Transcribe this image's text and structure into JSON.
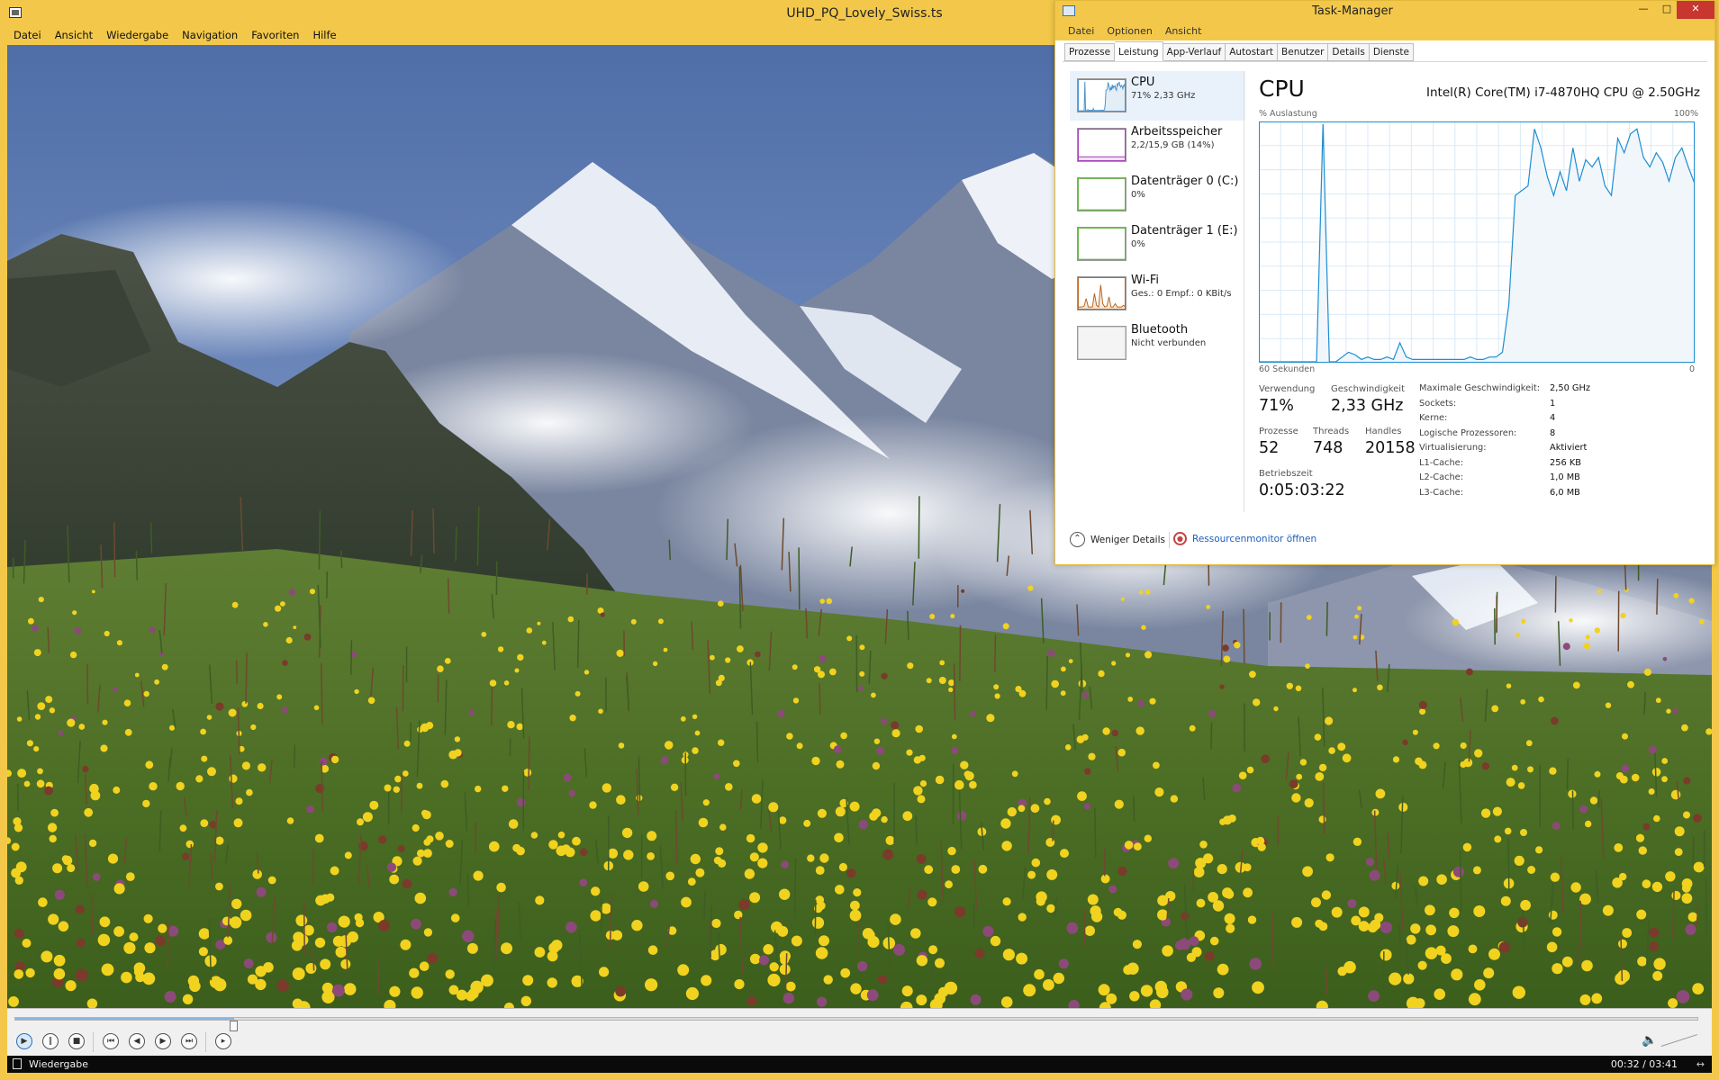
{
  "player": {
    "title": "UHD_PQ_Lovely_Swiss.ts",
    "menu": [
      "Datei",
      "Ansicht",
      "Wiedergabe",
      "Navigation",
      "Favoriten",
      "Hilfe"
    ],
    "seek_progress": 0.13,
    "status_text": "Wiedergabe",
    "time": "00:32 / 03:41",
    "resize_glyph": "↔",
    "controls": [
      {
        "name": "play-button",
        "icon": "play-icon",
        "glyph": "▶"
      },
      {
        "name": "pause-button",
        "icon": "pause-icon",
        "glyph": "‖"
      },
      {
        "name": "stop-button",
        "icon": "stop-icon",
        "glyph": "■"
      },
      {
        "name": "previous-button",
        "icon": "skip-back-icon",
        "glyph": "⏮"
      },
      {
        "name": "rewind-button",
        "icon": "rewind-icon",
        "glyph": "◀"
      },
      {
        "name": "forward-button",
        "icon": "forward-icon",
        "glyph": "▶"
      },
      {
        "name": "next-button",
        "icon": "skip-forward-icon",
        "glyph": "⏭"
      },
      {
        "name": "frame-step-button",
        "icon": "frame-step-icon",
        "glyph": "▸"
      }
    ]
  },
  "taskmgr": {
    "title": "Task-Manager",
    "menu": [
      "Datei",
      "Optionen",
      "Ansicht"
    ],
    "tabs": [
      "Prozesse",
      "Leistung",
      "App-Verlauf",
      "Autostart",
      "Benutzer",
      "Details",
      "Dienste"
    ],
    "active_tab": "Leistung",
    "sidebar": [
      {
        "name": "CPU",
        "sub": "71% 2,33 GHz",
        "color": "#4a90c8",
        "thumb": "cpu"
      },
      {
        "name": "Arbeitsspeicher",
        "sub": "2,2/15,9 GB (14%)",
        "color": "#a13eb6",
        "thumb": "memory"
      },
      {
        "name": "Datenträger 0 (C:)",
        "sub": "0%",
        "color": "#67b34a",
        "thumb": "flat"
      },
      {
        "name": "Datenträger 1 (E:)",
        "sub": "0%",
        "color": "#67b34a",
        "thumb": "flat"
      },
      {
        "name": "Wi-Fi",
        "sub": "Ges.: 0 Empf.: 0 KBit/s",
        "color": "#b8641f",
        "thumb": "wifi"
      },
      {
        "name": "Bluetooth",
        "sub": "Nicht verbunden",
        "color": "#999999",
        "thumb": "none"
      }
    ],
    "cpu": {
      "heading": "CPU",
      "model": "Intel(R) Core(TM) i7-4870HQ CPU @ 2.50GHz",
      "y_label": "% Auslastung",
      "y_max": "100%",
      "x_label": "60 Sekunden",
      "x_min": "0",
      "line_color": "#1d8ed1",
      "fill_color": "#f1f6fb",
      "grid_color": "#d9eaf7",
      "history_percent": [
        0,
        0,
        0,
        0,
        0,
        0,
        0,
        0,
        0,
        0,
        100,
        0,
        0,
        2,
        4,
        3,
        1,
        2,
        1,
        1,
        2,
        1,
        8,
        2,
        1,
        1,
        1,
        1,
        1,
        1,
        1,
        1,
        1,
        2,
        1,
        1,
        2,
        2,
        4,
        24,
        70,
        72,
        74,
        98,
        90,
        78,
        70,
        80,
        72,
        90,
        76,
        85,
        82,
        86,
        74,
        70,
        94,
        88,
        96,
        98,
        86,
        82,
        88,
        84,
        76,
        86,
        90,
        82,
        75
      ],
      "stats": {
        "usage_label": "Verwendung",
        "usage": "71%",
        "speed_label": "Geschwindigkeit",
        "speed": "2,33 GHz",
        "procs_label": "Prozesse",
        "procs": "52",
        "threads_label": "Threads",
        "threads": "748",
        "handles_label": "Handles",
        "handles": "20158",
        "uptime_label": "Betriebszeit",
        "uptime": "0:05:03:22"
      },
      "details": [
        [
          "Maximale Geschwindigkeit:",
          "2,50 GHz"
        ],
        [
          "Sockets:",
          "1"
        ],
        [
          "Kerne:",
          "4"
        ],
        [
          "Logische Prozessoren:",
          "8"
        ],
        [
          "Virtualisierung:",
          "Aktiviert"
        ],
        [
          "L1-Cache:",
          "256 KB"
        ],
        [
          "L2-Cache:",
          "1,0 MB"
        ],
        [
          "L3-Cache:",
          "6,0 MB"
        ]
      ]
    },
    "footer": {
      "fewer_details": "Weniger Details",
      "resource_monitor": "Ressourcenmonitor öffnen"
    }
  }
}
